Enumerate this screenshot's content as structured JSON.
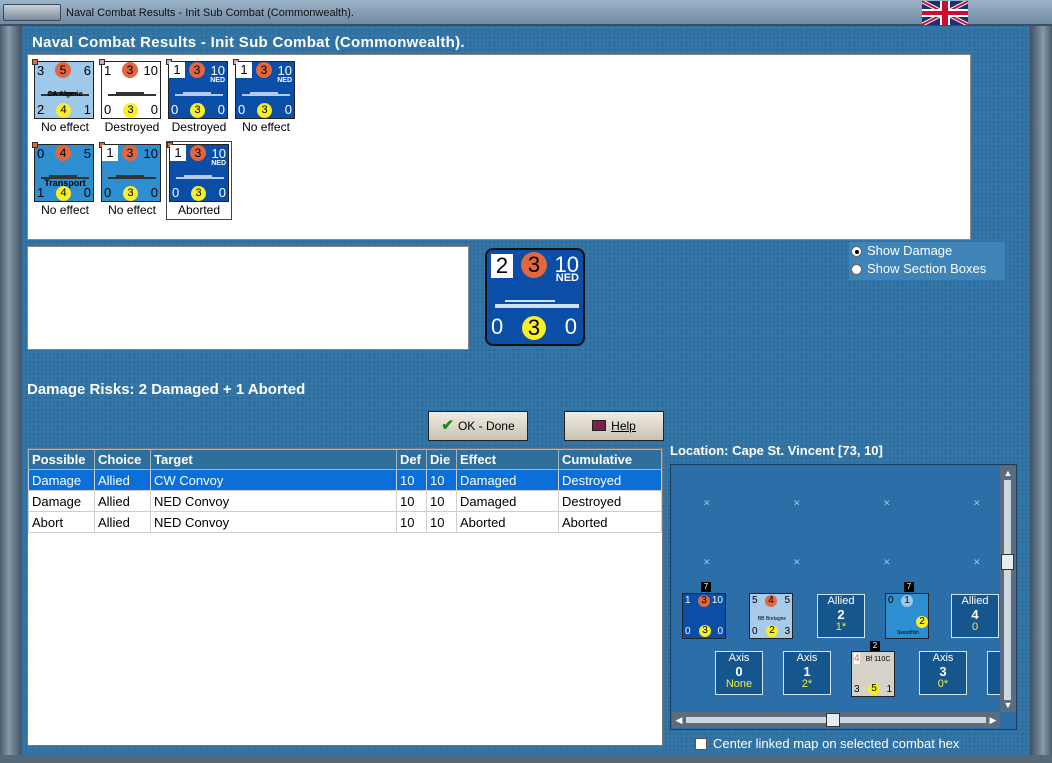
{
  "window": {
    "title": "Naval Combat Results - Init Sub Combat (Commonwealth)."
  },
  "heading": "Naval Combat Results - Init Sub Combat (Commonwealth).",
  "units": [
    {
      "top": "3",
      "circle": "5",
      "right": "6",
      "bottom_left": "2",
      "bottom_circle": "4",
      "bottom_right": "1",
      "name": "CA Algerie",
      "sub": "",
      "result": "No effect",
      "style": "lb"
    },
    {
      "top": "1",
      "circle": "3",
      "right": "10",
      "bottom_left": "0",
      "bottom_circle": "3",
      "bottom_right": "0",
      "name": "",
      "sub": "",
      "result": "Destroyed",
      "style": "wh"
    },
    {
      "top": "1",
      "circle": "3",
      "right": "10",
      "bottom_left": "0",
      "bottom_circle": "3",
      "bottom_right": "0",
      "name": "",
      "sub": "NED",
      "result": "Destroyed",
      "style": "db"
    },
    {
      "top": "1",
      "circle": "3",
      "right": "10",
      "bottom_left": "0",
      "bottom_circle": "3",
      "bottom_right": "0",
      "name": "",
      "sub": "NED",
      "result": "No effect",
      "style": "db"
    },
    {
      "top": "0",
      "circle": "4",
      "right": "5",
      "bottom_left": "1",
      "bottom_circle": "4",
      "bottom_right": "0",
      "name": "Transport",
      "sub": "",
      "result": "No effect",
      "style": "lb"
    },
    {
      "top": "1",
      "circle": "3",
      "right": "10",
      "bottom_left": "0",
      "bottom_circle": "3",
      "bottom_right": "0",
      "name": "",
      "sub": "",
      "result": "No effect",
      "style": "lb"
    },
    {
      "top": "1",
      "circle": "3",
      "right": "10",
      "bottom_left": "0",
      "bottom_circle": "3",
      "bottom_right": "0",
      "name": "",
      "sub": "NED",
      "result": "Aborted",
      "style": "db"
    }
  ],
  "big_counter": {
    "top": "2",
    "circle": "3",
    "right": "10",
    "sub": "NED",
    "bottom_left": "0",
    "bottom_circle": "3",
    "bottom_right": "0"
  },
  "options": {
    "show_damage": "Show Damage",
    "show_section_boxes": "Show Section Boxes"
  },
  "risks": "Damage Risks:  2 Damaged + 1 Aborted",
  "buttons": {
    "ok": "OK - Done",
    "help": "Help"
  },
  "table": {
    "headers": [
      "Possible",
      "Choice",
      "Target",
      "Def",
      "Die",
      "Effect",
      "Cumulative"
    ],
    "rows": [
      [
        "Damage",
        "Allied",
        "CW Convoy",
        "10",
        "10",
        "Damaged",
        "Destroyed"
      ],
      [
        "Damage",
        "Allied",
        "NED Convoy",
        "10",
        "10",
        "Damaged",
        "Destroyed"
      ],
      [
        "Abort",
        "Allied",
        "NED Convoy",
        "10",
        "10",
        "Aborted",
        "Aborted"
      ]
    ]
  },
  "location": "Location:  Cape St. Vincent [73, 10]",
  "map": {
    "allied_boxes": [
      {
        "label": "Allied",
        "num": "2",
        "val": "1*"
      },
      {
        "label": "Allied",
        "num": "4",
        "val": "0"
      }
    ],
    "axis_boxes": [
      {
        "label": "Axis",
        "num": "0",
        "val": "None"
      },
      {
        "label": "Axis",
        "num": "1",
        "val": "2*"
      },
      {
        "label": "Axis",
        "num": "3",
        "val": "0*"
      }
    ],
    "stack_counts": [
      "7",
      "7",
      "2"
    ],
    "mini_convoy": {
      "a": "1",
      "b": "3",
      "c": "10",
      "sub": "NED",
      "d": "0",
      "e": "3",
      "f": "0"
    },
    "mini_bb": {
      "a": "5",
      "b": "4",
      "c": "5",
      "name": "BB Bretagne",
      "d": "0",
      "e": "2",
      "f": "3"
    },
    "mini_swordfish": {
      "a": "0",
      "b": "1",
      "e": "2",
      "name": "Swordfish"
    },
    "mini_bf": {
      "a": "4",
      "name": "Bf 110C",
      "d": "3",
      "e": "5",
      "f": "1"
    }
  },
  "center_linked": "Center linked map on selected combat hex"
}
